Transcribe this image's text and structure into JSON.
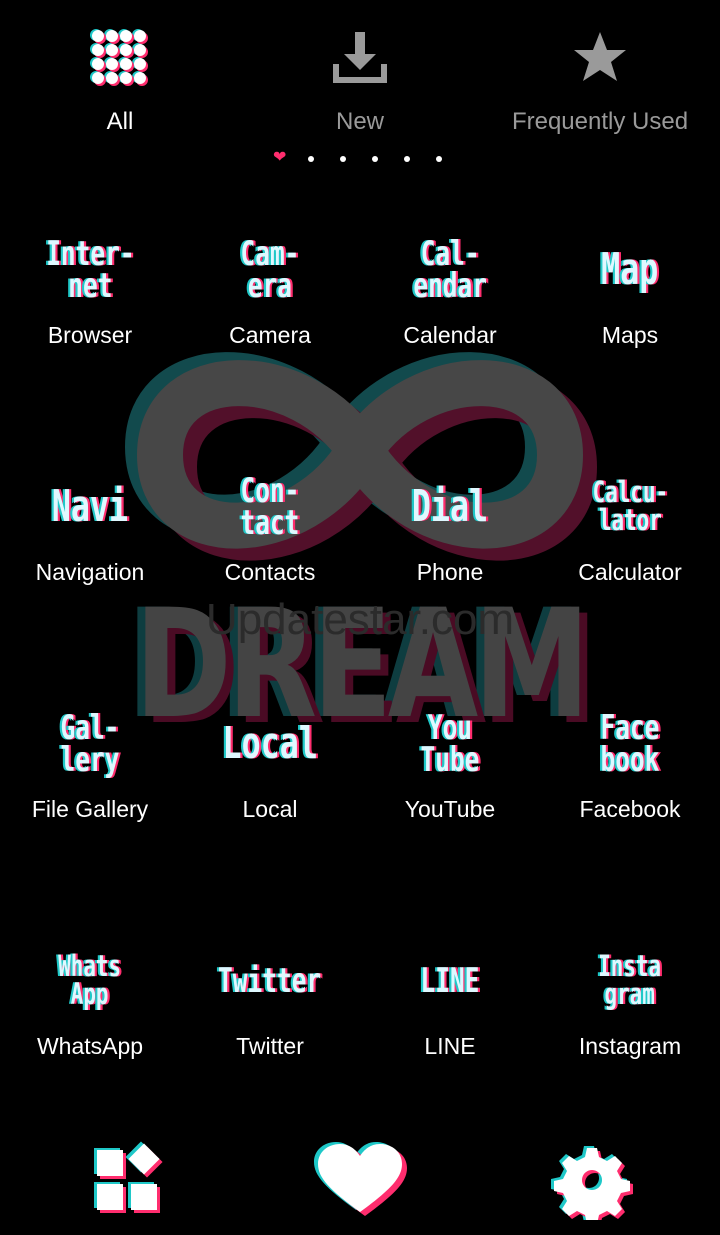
{
  "tabs": [
    {
      "label": "All",
      "icon": "grid-dots-icon",
      "active": true
    },
    {
      "label": "New",
      "icon": "download-icon",
      "active": false
    },
    {
      "label": "Frequently Used",
      "icon": "star-icon",
      "active": false
    }
  ],
  "pager": {
    "pages": 6,
    "current": 1
  },
  "apps": [
    {
      "icon_text": [
        "Inter-",
        "net"
      ],
      "label": "Browser"
    },
    {
      "icon_text": [
        "Cam-",
        "era"
      ],
      "label": "Camera"
    },
    {
      "icon_text": [
        "Cal-",
        "endar"
      ],
      "label": "Calendar"
    },
    {
      "icon_text": [
        "Map"
      ],
      "label": "Maps"
    },
    {
      "icon_text": [
        "Navi"
      ],
      "label": "Navigation"
    },
    {
      "icon_text": [
        "Con-",
        "tact"
      ],
      "label": "Contacts"
    },
    {
      "icon_text": [
        "Dial"
      ],
      "label": "Phone"
    },
    {
      "icon_text": [
        "Calcu-",
        "lator"
      ],
      "label": "Calculator"
    },
    {
      "icon_text": [
        "Gal-",
        "lery"
      ],
      "label": "File Gallery"
    },
    {
      "icon_text": [
        "Local"
      ],
      "label": "Local"
    },
    {
      "icon_text": [
        "You",
        "Tube"
      ],
      "label": "YouTube"
    },
    {
      "icon_text": [
        "Face",
        "book"
      ],
      "label": "Facebook"
    },
    {
      "icon_text": [
        "Whats",
        "App"
      ],
      "label": "WhatsApp"
    },
    {
      "icon_text": [
        "Twitter"
      ],
      "label": "Twitter"
    },
    {
      "icon_text": [
        "LINE"
      ],
      "label": "LINE"
    },
    {
      "icon_text": [
        "Insta",
        "gram"
      ],
      "label": "Instagram"
    }
  ],
  "background": {
    "word": "DREAM",
    "watermark": "Updatestar.com"
  },
  "dock": [
    {
      "icon": "widgets-icon"
    },
    {
      "icon": "heart-icon"
    },
    {
      "icon": "settings-gear-icon"
    }
  ],
  "colors": {
    "cyan": "#1fc8c8",
    "magenta": "#ff2d6e",
    "background": "#000000"
  }
}
